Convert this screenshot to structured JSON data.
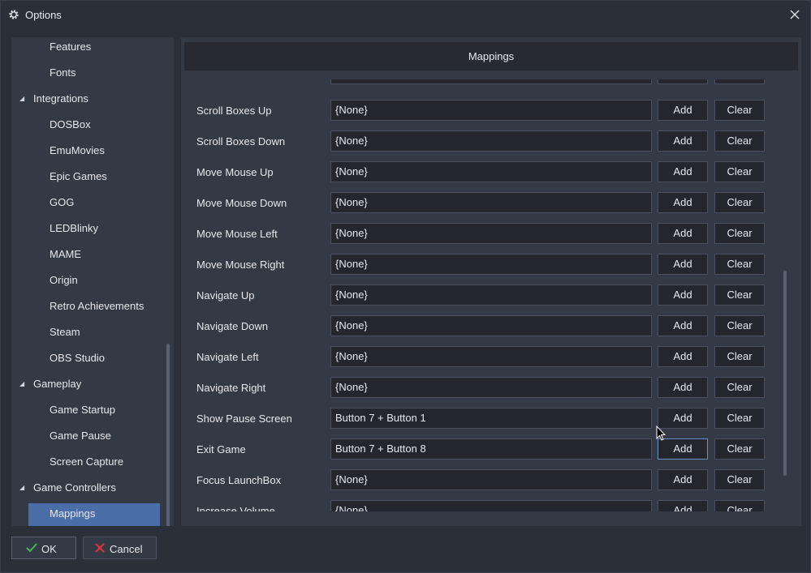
{
  "window": {
    "title": "Options",
    "title_icon": "gear-icon",
    "close_icon": "close-icon"
  },
  "sidebar": {
    "items": [
      {
        "label": "Features",
        "level": 2,
        "expandable": false
      },
      {
        "label": "Fonts",
        "level": 2,
        "expandable": false
      },
      {
        "label": "Integrations",
        "level": 1,
        "expandable": true
      },
      {
        "label": "DOSBox",
        "level": 2,
        "expandable": false
      },
      {
        "label": "EmuMovies",
        "level": 2,
        "expandable": false
      },
      {
        "label": "Epic Games",
        "level": 2,
        "expandable": false
      },
      {
        "label": "GOG",
        "level": 2,
        "expandable": false
      },
      {
        "label": "LEDBlinky",
        "level": 2,
        "expandable": false
      },
      {
        "label": "MAME",
        "level": 2,
        "expandable": false
      },
      {
        "label": "Origin",
        "level": 2,
        "expandable": false
      },
      {
        "label": "Retro Achievements",
        "level": 2,
        "expandable": false
      },
      {
        "label": "Steam",
        "level": 2,
        "expandable": false
      },
      {
        "label": "OBS Studio",
        "level": 2,
        "expandable": false
      },
      {
        "label": "Gameplay",
        "level": 1,
        "expandable": true
      },
      {
        "label": "Game Startup",
        "level": 2,
        "expandable": false
      },
      {
        "label": "Game Pause",
        "level": 2,
        "expandable": false
      },
      {
        "label": "Screen Capture",
        "level": 2,
        "expandable": false
      },
      {
        "label": "Game Controllers",
        "level": 1,
        "expandable": true
      },
      {
        "label": "Mappings",
        "level": 2,
        "expandable": false,
        "selected": true
      }
    ],
    "selected_color": "#4b6ea9"
  },
  "content": {
    "header": "Mappings",
    "add_label": "Add",
    "clear_label": "Clear",
    "rows": [
      {
        "label": "Scroll Boxes Up",
        "value": "{None}"
      },
      {
        "label": "Scroll Boxes Down",
        "value": "{None}"
      },
      {
        "label": "Move Mouse Up",
        "value": "{None}"
      },
      {
        "label": "Move Mouse Down",
        "value": "{None}"
      },
      {
        "label": "Move Mouse Left",
        "value": "{None}"
      },
      {
        "label": "Move Mouse Right",
        "value": "{None}"
      },
      {
        "label": "Navigate Up",
        "value": "{None}"
      },
      {
        "label": "Navigate Down",
        "value": "{None}"
      },
      {
        "label": "Navigate Left",
        "value": "{None}"
      },
      {
        "label": "Navigate Right",
        "value": "{None}"
      },
      {
        "label": "Show Pause Screen",
        "value": "Button 7 + Button 1"
      },
      {
        "label": "Exit Game",
        "value": "Button 7 + Button 8",
        "add_focused": true
      },
      {
        "label": "Focus LaunchBox",
        "value": "{None}"
      },
      {
        "label": "Increase Volume",
        "value": "{None}"
      }
    ]
  },
  "footer": {
    "ok_label": "OK",
    "ok_icon": "checkmark-icon",
    "cancel_label": "Cancel",
    "cancel_icon": "cancel-icon",
    "ok_color": "#4caf50",
    "cancel_color": "#d9363e"
  }
}
